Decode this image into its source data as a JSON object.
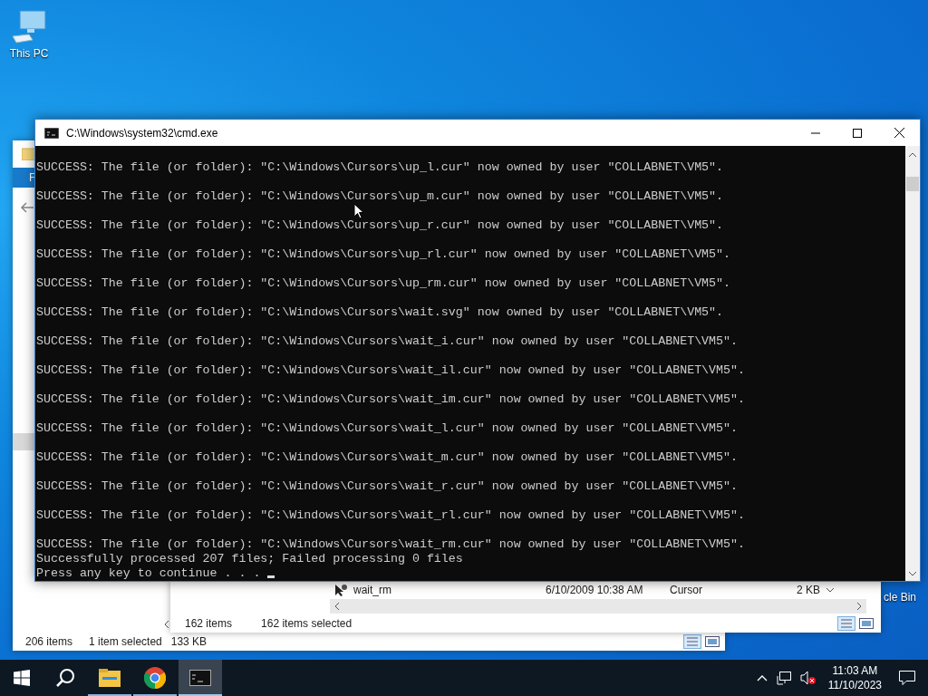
{
  "desktop_icons": [
    {
      "kind": "pc",
      "label": "This PC"
    },
    {
      "kind": "bin",
      "label": "cle Bin"
    }
  ],
  "explorer_back": {
    "ribbon_tab": "F",
    "status": [
      "206 items",
      "1 item selected",
      "133 KB"
    ]
  },
  "explorer_front": {
    "row": {
      "name": "wait_rm",
      "date": "6/10/2009 10:38 AM",
      "type": "Cursor",
      "size": "2 KB"
    },
    "status": [
      "162 items",
      "162 items selected"
    ]
  },
  "console": {
    "title": "C:\\Windows\\system32\\cmd.exe",
    "lines": [
      "SUCCESS: The file (or folder): \"C:\\Windows\\Cursors\\up_l.cur\" now owned by user \"COLLABNET\\VM5\".",
      "SUCCESS: The file (or folder): \"C:\\Windows\\Cursors\\up_m.cur\" now owned by user \"COLLABNET\\VM5\".",
      "SUCCESS: The file (or folder): \"C:\\Windows\\Cursors\\up_r.cur\" now owned by user \"COLLABNET\\VM5\".",
      "SUCCESS: The file (or folder): \"C:\\Windows\\Cursors\\up_rl.cur\" now owned by user \"COLLABNET\\VM5\".",
      "SUCCESS: The file (or folder): \"C:\\Windows\\Cursors\\up_rm.cur\" now owned by user \"COLLABNET\\VM5\".",
      "SUCCESS: The file (or folder): \"C:\\Windows\\Cursors\\wait.svg\" now owned by user \"COLLABNET\\VM5\".",
      "SUCCESS: The file (or folder): \"C:\\Windows\\Cursors\\wait_i.cur\" now owned by user \"COLLABNET\\VM5\".",
      "SUCCESS: The file (or folder): \"C:\\Windows\\Cursors\\wait_il.cur\" now owned by user \"COLLABNET\\VM5\".",
      "SUCCESS: The file (or folder): \"C:\\Windows\\Cursors\\wait_im.cur\" now owned by user \"COLLABNET\\VM5\".",
      "SUCCESS: The file (or folder): \"C:\\Windows\\Cursors\\wait_l.cur\" now owned by user \"COLLABNET\\VM5\".",
      "SUCCESS: The file (or folder): \"C:\\Windows\\Cursors\\wait_m.cur\" now owned by user \"COLLABNET\\VM5\".",
      "SUCCESS: The file (or folder): \"C:\\Windows\\Cursors\\wait_r.cur\" now owned by user \"COLLABNET\\VM5\".",
      "SUCCESS: The file (or folder): \"C:\\Windows\\Cursors\\wait_rl.cur\" now owned by user \"COLLABNET\\VM5\".",
      "SUCCESS: The file (or folder): \"C:\\Windows\\Cursors\\wait_rm.cur\" now owned by user \"COLLABNET\\VM5\"."
    ],
    "summary": "Successfully processed 207 files; Failed processing 0 files",
    "prompt": "Press any key to continue . . ."
  },
  "taskbar": {
    "apps": [
      {
        "kind": "start",
        "selected": false
      },
      {
        "kind": "search",
        "selected": false
      },
      {
        "kind": "explorer",
        "selected": false
      },
      {
        "kind": "chrome",
        "selected": false
      },
      {
        "kind": "console",
        "selected": true
      }
    ],
    "volume_muted": true,
    "time": "11:03 AM",
    "date": "11/10/2023"
  }
}
